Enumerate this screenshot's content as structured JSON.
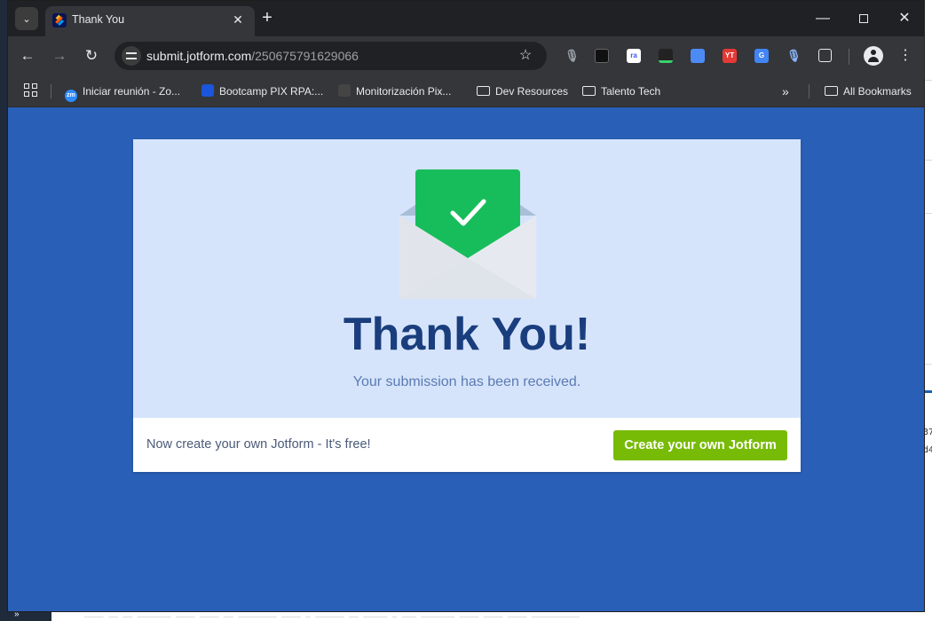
{
  "browser": {
    "tab": {
      "title": "Thank You"
    },
    "address_bar": {
      "domain": "submit.jotform.com",
      "path": "/250675791629066"
    },
    "extensions": [
      {
        "label": "ra",
        "color": "#ffffff",
        "text_color": "#3a55ff"
      },
      {
        "label": "YT",
        "color": "#e53935",
        "text_color": "#ffffff"
      }
    ],
    "bookmarks": [
      {
        "label": "Iniciar reunión - Zo...",
        "icon": "zoom-icon",
        "color": "#2d8cff"
      },
      {
        "label": "Bootcamp PIX RPA:...",
        "icon": "bootcamp-icon",
        "color": "#1a56db"
      },
      {
        "label": "Monitorización Pix...",
        "icon": "monitor-icon",
        "color": "#444444"
      },
      {
        "label": "Dev Resources",
        "icon": "folder-icon"
      },
      {
        "label": "Talento Tech",
        "icon": "folder-icon"
      }
    ],
    "all_bookmarks_label": "All Bookmarks",
    "zoom_favicon_text": "zm"
  },
  "page": {
    "title": "Thank You!",
    "subtitle": "Your submission has been received.",
    "footer": {
      "promo_text": "Now create your own Jotform - It's free!",
      "cta_label": "Create your own Jotform"
    }
  },
  "desktop": {
    "fragments": [
      "37",
      "d4"
    ],
    "bottom_text": "____ __ __ _______ ____ ____ __ ________ ____ _ ______ __ _____ _ ___ _______ ____ ____ ____ __________"
  },
  "colors": {
    "page_bg": "#2a5fb7",
    "card_bg": "#d6e4fb",
    "title": "#1a3e7d",
    "cta": "#78bb07",
    "check_green": "#18bd5b"
  }
}
